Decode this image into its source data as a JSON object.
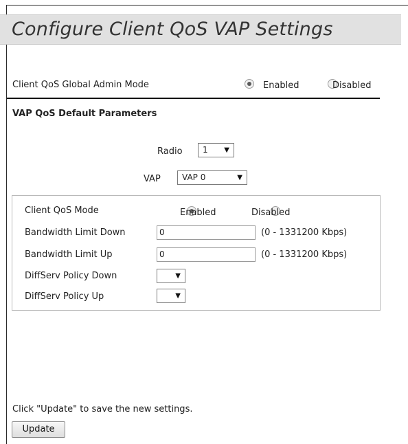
{
  "page": {
    "title": "Configure Client QoS VAP Settings"
  },
  "global": {
    "label": "Client QoS Global Admin Mode",
    "enabled_label": "Enabled",
    "disabled_label": "Disabled",
    "selected": "Enabled"
  },
  "section": {
    "heading": "VAP QoS Default Parameters"
  },
  "radio_select": {
    "label": "Radio",
    "value": "1"
  },
  "vap_select": {
    "label": "VAP",
    "value": "VAP 0"
  },
  "client": {
    "mode_label": "Client QoS Mode",
    "enabled_label": "Enabled",
    "disabled_label": "Disabled",
    "selected": "Enabled",
    "bw_down_label": "Bandwidth Limit Down",
    "bw_down_value": "0",
    "bw_down_range": "(0 - 1331200 Kbps)",
    "bw_up_label": "Bandwidth Limit Up",
    "bw_up_value": "0",
    "bw_up_range": "(0 - 1331200 Kbps)",
    "diffserv_down_label": "DiffServ Policy Down",
    "diffserv_down_value": "",
    "diffserv_up_label": "DiffServ Policy Up",
    "diffserv_up_value": ""
  },
  "footer": {
    "hint": "Click \"Update\" to save the new settings.",
    "update_label": "Update"
  },
  "icons": {
    "dropdown": "chevron-down-icon",
    "arrow_glyph": "▼"
  }
}
